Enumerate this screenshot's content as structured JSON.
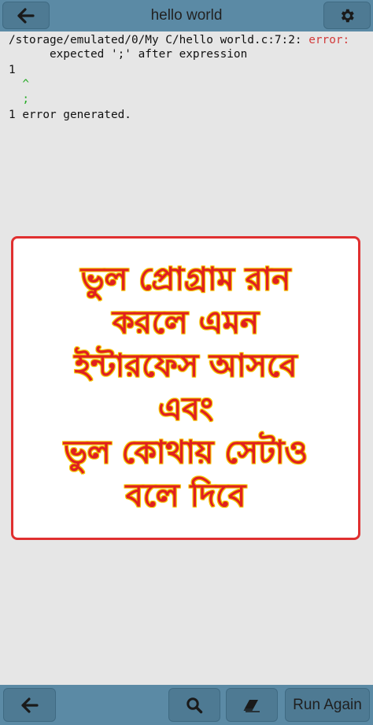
{
  "header": {
    "title": "hello world",
    "back_icon": "arrow-left-icon",
    "settings_icon": "gear-icon"
  },
  "console": {
    "lines": [
      {
        "text": "/storage/emulated/0/My C/hello world.c:7:2: ",
        "suffix": "error:"
      },
      {
        "text": "      expected ';' after expression"
      },
      {
        "text": "1"
      },
      {
        "text": "  ^"
      },
      {
        "text": "  ;"
      },
      {
        "text": "1 error generated."
      }
    ]
  },
  "overlay": {
    "lines": [
      "ভুল প্রোগ্রাম রান",
      "করলে এমন",
      "ইন্টারফেস আসবে",
      "এবং",
      "ভুল কোথায় সেটাও",
      "বলে দিবে"
    ]
  },
  "footer": {
    "back_icon": "arrow-left-icon",
    "search_icon": "search-icon",
    "clear_icon": "eraser-icon",
    "run_again_label": "Run Again"
  },
  "colors": {
    "bar": "#5b8aa5",
    "button": "#4e7a93",
    "console_bg": "#e6e6e6",
    "error_red": "#d23a3a",
    "caret_green": "#22aa22",
    "overlay_text": "#e02020",
    "overlay_outline": "#f4c400"
  }
}
